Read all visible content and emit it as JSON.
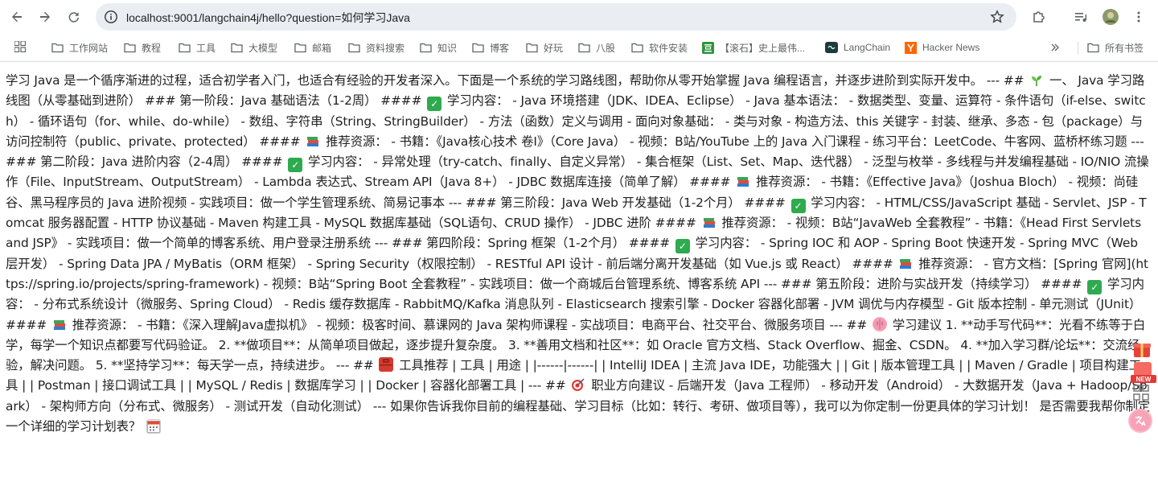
{
  "browser": {
    "url": "localhost:9001/langchain4j/hello?question=如何学习Java"
  },
  "bookmarks": [
    {
      "label": "工作网站",
      "icon": "folder-icon"
    },
    {
      "label": "教程",
      "icon": "folder-icon"
    },
    {
      "label": "工具",
      "icon": "folder-icon"
    },
    {
      "label": "大模型",
      "icon": "folder-icon"
    },
    {
      "label": "邮箱",
      "icon": "folder-icon"
    },
    {
      "label": "资料搜索",
      "icon": "folder-icon"
    },
    {
      "label": "知识",
      "icon": "folder-icon"
    },
    {
      "label": "博客",
      "icon": "folder-icon"
    },
    {
      "label": "好玩",
      "icon": "folder-icon"
    },
    {
      "label": "八股",
      "icon": "folder-icon"
    },
    {
      "label": "软件安装",
      "icon": "folder-icon"
    },
    {
      "label": "【滚石】史上最伟...",
      "icon": "douban-icon"
    },
    {
      "label": "LangChain",
      "icon": "langchain-icon"
    },
    {
      "label": "Hacker News",
      "icon": "hackernews-icon"
    }
  ],
  "all_bookmarks_label": "所有书签",
  "content": {
    "p1": "学习 Java 是一个循序渐进的过程，适合初学者入门，也适合有经验的开发者深入。下面是一个系统的学习路线图，帮助你从零开始掌握 Java 编程语言，并逐步进阶到实际开发中。 --- ## ",
    "p2": " 一、 Java 学习路线图（从零基础到进阶） ### 第一阶段：Java 基础语法（1-2周） #### ",
    "p3": " 学习内容： - Java 环境搭建（JDK、IDEA、Eclipse） - Java 基本语法： - 数据类型、变量、运算符 - 条件语句（if-else、switch） - 循环语句（for、while、do-while） - 数组、字符串（String、StringBuilder） - 方法（函数）定义与调用 - 面向对象基础： - 类与对象 - 构造方法、this 关键字 - 封装、继承、多态 - 包（package）与访问控制符（public、private、protected） #### ",
    "p4": " 推荐资源： - 书籍：《Java核心技术 卷I》（Core Java） - 视频：B站/YouTube 上的 Java 入门课程 - 练习平台：LeetCode、牛客网、蓝桥杯练习题 --- ### 第二阶段：Java 进阶内容（2-4周） #### ",
    "p5": " 学习内容： - 异常处理（try-catch、finally、自定义异常） - 集合框架（List、Set、Map、迭代器） - 泛型与枚举 - 多线程与并发编程基础 - IO/NIO 流操作（File、InputStream、OutputStream） - Lambda 表达式、Stream API（Java 8+） - JDBC 数据库连接（简单了解） #### ",
    "p6": " 推荐资源： - 书籍：《Effective Java》（Joshua Bloch） - 视频：尚硅谷、黑马程序员的 Java 进阶视频 - 实践项目：做一个学生管理系统、简易记事本 --- ### 第三阶段：Java Web 开发基础（1-2个月） #### ",
    "p7": " 学习内容： - HTML/CSS/JavaScript 基础 - Servlet、JSP - Tomcat 服务器配置 - HTTP 协议基础 - Maven 构建工具 - MySQL 数据库基础（SQL语句、CRUD 操作） - JDBC 进阶 #### ",
    "p8": " 推荐资源： - 视频：B站“JavaWeb 全套教程” - 书籍：《Head First Servlets and JSP》 - 实践项目：做一个简单的博客系统、用户登录注册系统 --- ### 第四阶段：Spring 框架（1-2个月） #### ",
    "p9": " 学习内容： - Spring IOC 和 AOP - Spring Boot 快速开发 - Spring MVC（Web 层开发） - Spring Data JPA / MyBatis（ORM 框架） - Spring Security（权限控制） - RESTful API 设计 - 前后端分离开发基础（如 Vue.js 或 React） #### ",
    "p10": " 推荐资源： - 官方文档：[Spring 官网](https://spring.io/projects/spring-framework) - 视频：B站“Spring Boot 全套教程” - 实践项目：做一个商城后台管理系统、博客系统 API --- ### 第五阶段：进阶与实战开发（持续学习） #### ",
    "p11": " 学习内容： - 分布式系统设计（微服务、Spring Cloud） - Redis 缓存数据库 - RabbitMQ/Kafka 消息队列 - Elasticsearch 搜索引擎 - Docker 容器化部署 - JVM 调优与内存模型 - Git 版本控制 - 单元测试（JUnit） #### ",
    "p12": " 推荐资源： - 书籍：《深入理解Java虚拟机》 - 视频：极客时间、慕课网的 Java 架构师课程 - 实战项目：电商平台、社交平台、微服务项目 --- ## ",
    "p13": " 学习建议 1. **动手写代码**：光看不练等于白学，每学一个知识点都要写代码验证。 2. **做项目**：从简单项目做起，逐步提升复杂度。 3. **善用文档和社区**：如 Oracle 官方文档、Stack Overflow、掘金、CSDN。 4. **加入学习群/论坛**：交流经验，解决问题。 5. **坚持学习**：每天学一点，持续进步。 --- ## ",
    "p14": " 工具推荐 | 工具 | 用途 | |------|------| | IntelliJ IDEA | 主流 Java IDE，功能强大 | | Git | 版本管理工具 | | Maven / Gradle | 项目构建工具 | | Postman | 接口调试工具 | | MySQL / Redis | 数据库学习 | | Docker | 容器化部署工具 | --- ## ",
    "p15": " 职业方向建议 - 后端开发（Java 工程师） - 移动开发（Android） - 大数据开发（Java + Hadoop/Spark） - 架构师方向（分布式、微服务） - 测试开发（自动化测试） --- 如果你告诉我你目前的编程基础、学习目标（比如：转行、考研、做项目等），我可以为你定制一份更具体的学习计划！ 是否需要我帮你制定一个详细的学习计划表？ ",
    "floating_badge": "NEW"
  }
}
